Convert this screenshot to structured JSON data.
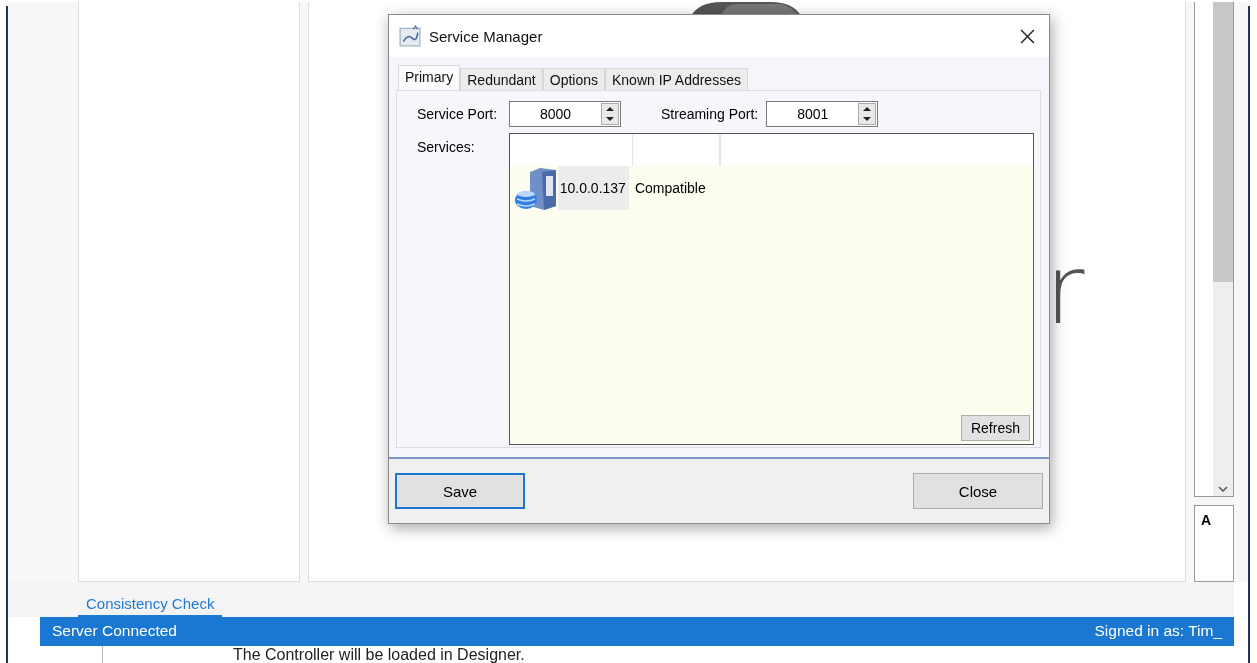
{
  "background": {
    "large_text": "r",
    "side_box_label": "A",
    "bottom_tab": {
      "label": "Consistency Check",
      "selected": true
    },
    "status_bar": {
      "left": "Server Connected",
      "right": "Signed in as: Tim_"
    },
    "footer_text": "The Controller will be loaded in Designer."
  },
  "dialog": {
    "title": "Service Manager",
    "tabs": [
      {
        "label": "Primary",
        "selected": true
      },
      {
        "label": "Redundant",
        "selected": false
      },
      {
        "label": "Options",
        "selected": false
      },
      {
        "label": "Known IP Addresses",
        "selected": false
      }
    ],
    "service_port": {
      "label": "Service Port:",
      "value": "8000"
    },
    "streaming_port": {
      "label": "Streaming Port:",
      "value": "8001"
    },
    "services": {
      "label": "Services:",
      "rows": [
        {
          "address": "10.0.0.137",
          "status": "Compatible"
        }
      ],
      "refresh": "Refresh"
    },
    "buttons": [
      {
        "label": "Save",
        "default": true
      },
      {
        "label": "Close",
        "default": false
      }
    ]
  }
}
